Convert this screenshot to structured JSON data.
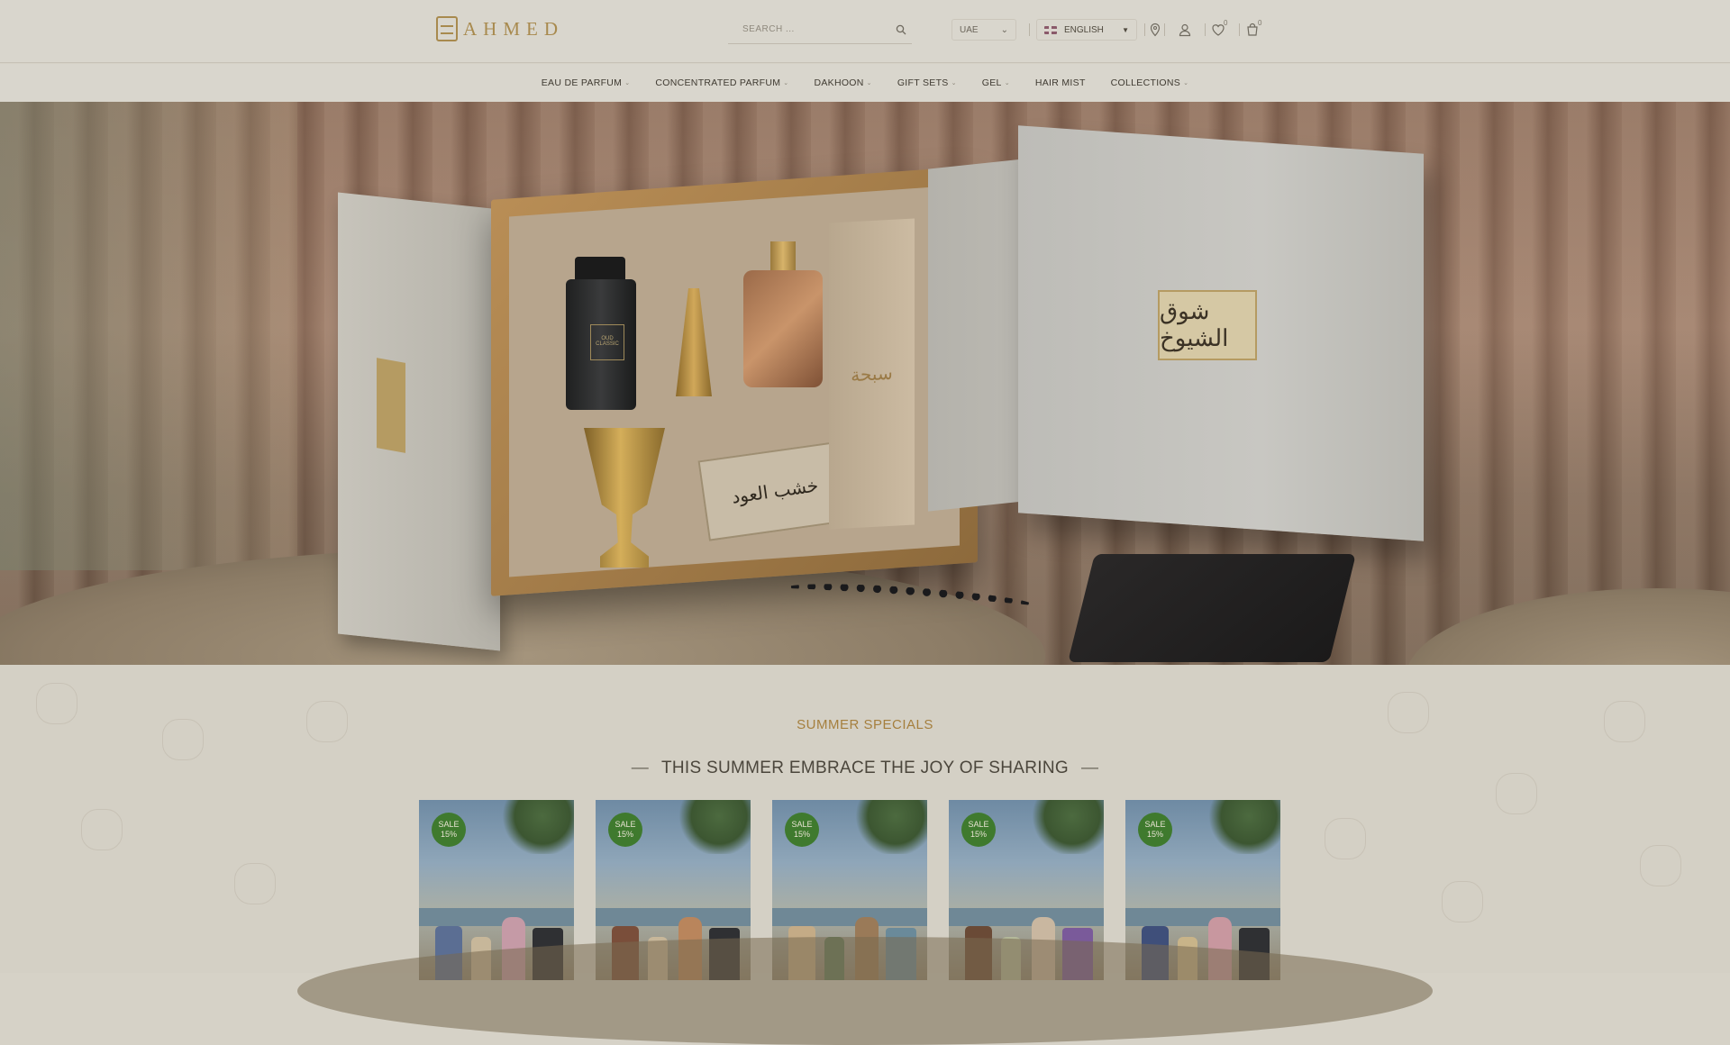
{
  "header": {
    "logo_text": "AHMED",
    "search_placeholder": "SEARCH ...",
    "country": "UAE",
    "language": "ENGLISH",
    "wishlist_count": "0",
    "cart_count": "0"
  },
  "nav": {
    "items": [
      {
        "label": "EAU DE PARFUM"
      },
      {
        "label": "CONCENTRATED PARFUM"
      },
      {
        "label": "DAKHOON"
      },
      {
        "label": "GIFT SETS"
      },
      {
        "label": "GEL"
      },
      {
        "label": "HAIR MIST"
      },
      {
        "label": "COLLECTIONS"
      }
    ]
  },
  "hero": {
    "lid_label": "شوق الشيوخ",
    "box_label_tall": "سبحة",
    "box_label_wood": "خشب العود",
    "bottle_label": "OUD CLASSIC"
  },
  "specials": {
    "kicker": "SUMMER SPECIALS",
    "title": "THIS SUMMER EMBRACE THE JOY OF SHARING",
    "cards": [
      {
        "sale_label": "SALE",
        "sale_pct": "15%"
      },
      {
        "sale_label": "SALE",
        "sale_pct": "15%"
      },
      {
        "sale_label": "SALE",
        "sale_pct": "15%"
      },
      {
        "sale_label": "SALE",
        "sale_pct": "15%"
      },
      {
        "sale_label": "SALE",
        "sale_pct": "15%"
      }
    ]
  },
  "colors": {
    "accent_gold": "#a88a4e",
    "sale_green": "#3f7a2e"
  }
}
